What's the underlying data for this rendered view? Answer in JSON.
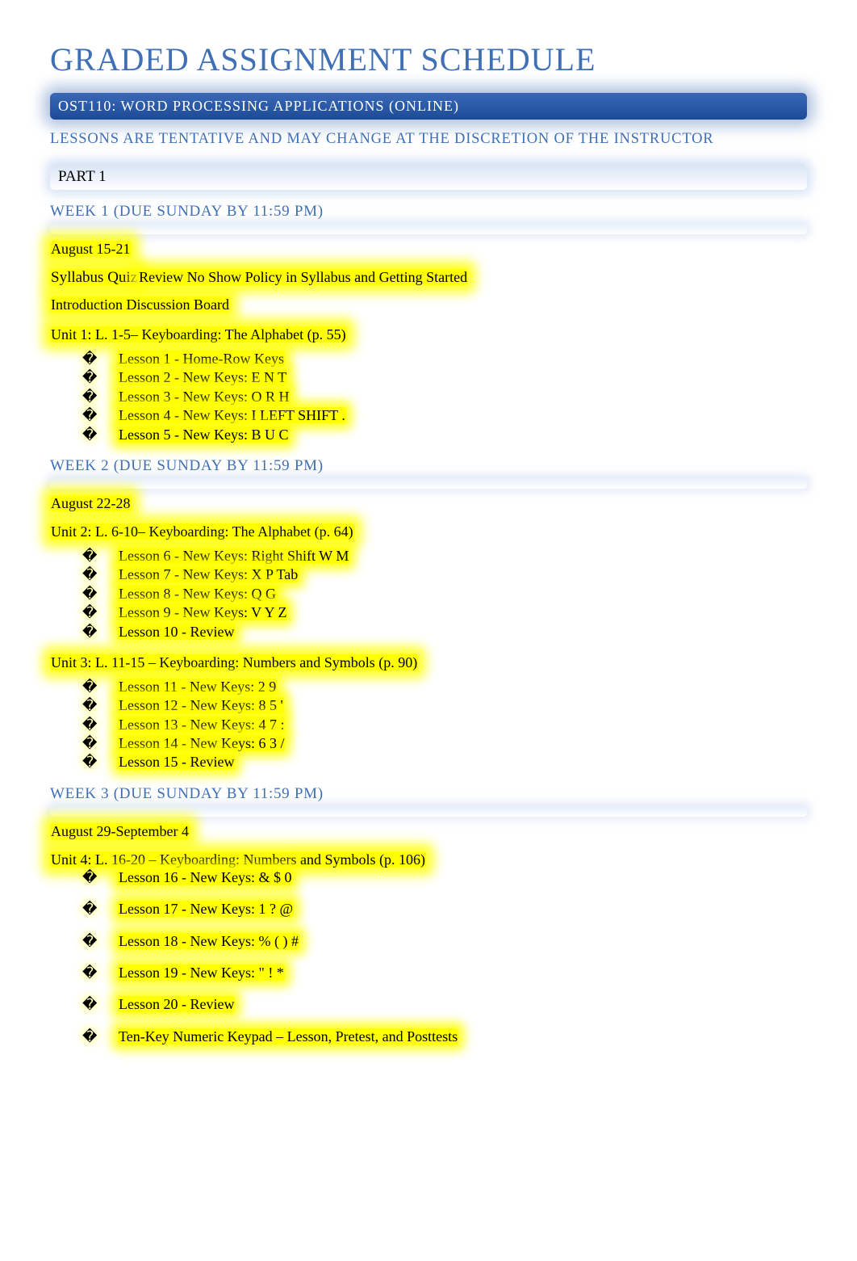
{
  "title": "GRADED ASSIGNMENT SCHEDULE",
  "course": "OST110: WORD PROCESSING APPLICATIONS (ONLINE)",
  "disclaimer": "LESSONS ARE TENTATIVE AND MAY CHANGE AT THE DISCRETION OF THE INSTRUCTOR",
  "part": "PART 1",
  "week1": {
    "heading": "WEEK 1 (DUE SUNDAY BY 11:59 PM)",
    "date": "August 15-21",
    "syllabus_label": "Syllabus Quiz",
    "syllabus_text": "Review No Show Policy in Syllabus and Getting Started",
    "intro": "Introduction Discussion Board",
    "unit": "Unit 1: L. 1-5– Keyboarding: The Alphabet (p. 55)",
    "lessons": [
      "Lesson 1 - Home-Row Keys",
      "Lesson 2 - New Keys: E N T",
      "Lesson 3 - New Keys: O R H",
      "Lesson 4 - New Keys: I LEFT SHIFT .",
      "Lesson 5 - New Keys: B U C"
    ]
  },
  "week2": {
    "heading": "WEEK 2 (DUE SUNDAY BY 11:59 PM)",
    "date": "August 22-28",
    "unit_a": "Unit 2: L. 6-10– Keyboarding: The Alphabet (p. 64)",
    "lessons_a": [
      "Lesson 6 - New Keys: Right Shift W M",
      "Lesson 7 - New Keys: X P Tab",
      "Lesson 8 - New Keys: Q G",
      "Lesson 9 - New Keys: V Y Z",
      "Lesson 10 - Review"
    ],
    "unit_b": "Unit 3: L. 11-15 – Keyboarding: Numbers and Symbols (p. 90)",
    "lessons_b": [
      "Lesson 11 - New Keys: 2 9",
      "Lesson 12 - New Keys: 8 5 '",
      "Lesson 13 - New Keys: 4 7 :",
      "Lesson 14 - New Keys: 6 3 /",
      "Lesson 15 - Review"
    ]
  },
  "week3": {
    "heading": "WEEK 3 (DUE SUNDAY BY 11:59 PM)",
    "date": "August 29-September 4",
    "unit": "Unit 4: L. 16-20 – Keyboarding: Numbers and Symbols (p. 106)",
    "lessons": [
      "Lesson 16 - New Keys: & $ 0",
      "Lesson 17 - New Keys: 1 ? @",
      "Lesson 18 - New Keys: % ( ) #",
      "Lesson 19 - New Keys: \" ! *",
      "Lesson 20 - Review",
      "Ten-Key Numeric Keypad – Lesson, Pretest, and Posttests"
    ]
  }
}
